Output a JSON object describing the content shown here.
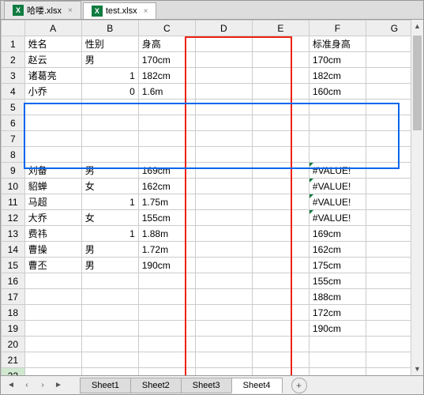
{
  "file_tabs": [
    {
      "name": "哈喽.xlsx",
      "active": false
    },
    {
      "name": "test.xlsx",
      "active": true
    }
  ],
  "columns": [
    "A",
    "B",
    "C",
    "D",
    "E",
    "F",
    "G"
  ],
  "row_count": 22,
  "cells": {
    "1": {
      "A": "姓名",
      "B": "性别",
      "C": "身高",
      "F": "标准身高"
    },
    "2": {
      "A": "赵云",
      "B": "男",
      "C": "170cm",
      "F": "170cm"
    },
    "3": {
      "A": "诸葛亮",
      "B": "1",
      "B_num": true,
      "C": "182cm",
      "F": "182cm"
    },
    "4": {
      "A": "小乔",
      "B": "0",
      "B_num": true,
      "C": "1.6m",
      "F": "160cm"
    },
    "9": {
      "A": "刘备",
      "B": "男",
      "C": "169cm",
      "F": "#VALUE!",
      "F_err": true
    },
    "10": {
      "A": "貂蝉",
      "B": "女",
      "C": "162cm",
      "F": "#VALUE!",
      "F_err": true
    },
    "11": {
      "A": "马超",
      "B": "1",
      "B_num": true,
      "C": "1.75m",
      "F": "#VALUE!",
      "F_err": true
    },
    "12": {
      "A": "大乔",
      "B": "女",
      "C": "155cm",
      "F": "#VALUE!",
      "F_err": true
    },
    "13": {
      "A": "费祎",
      "B": "1",
      "B_num": true,
      "C": "1.88m",
      "F": "169cm"
    },
    "14": {
      "A": "曹操",
      "B": "男",
      "C": "1.72m",
      "F": "162cm"
    },
    "15": {
      "A": "曹丕",
      "B": "男",
      "C": "190cm",
      "F": "175cm"
    },
    "16": {
      "F": "155cm"
    },
    "17": {
      "F": "188cm"
    },
    "18": {
      "F": "172cm"
    },
    "19": {
      "F": "190cm"
    }
  },
  "sheet_tabs": [
    "Sheet1",
    "Sheet2",
    "Sheet3",
    "Sheet4"
  ],
  "active_sheet": "Sheet4",
  "overlays": {
    "red": {
      "left_col": "D",
      "right_col": "E",
      "top_row": 1,
      "bottom_row": 21
    },
    "blue": {
      "left_col": "A",
      "right_col": "G",
      "top_row": 5,
      "bottom_row": 8
    }
  }
}
